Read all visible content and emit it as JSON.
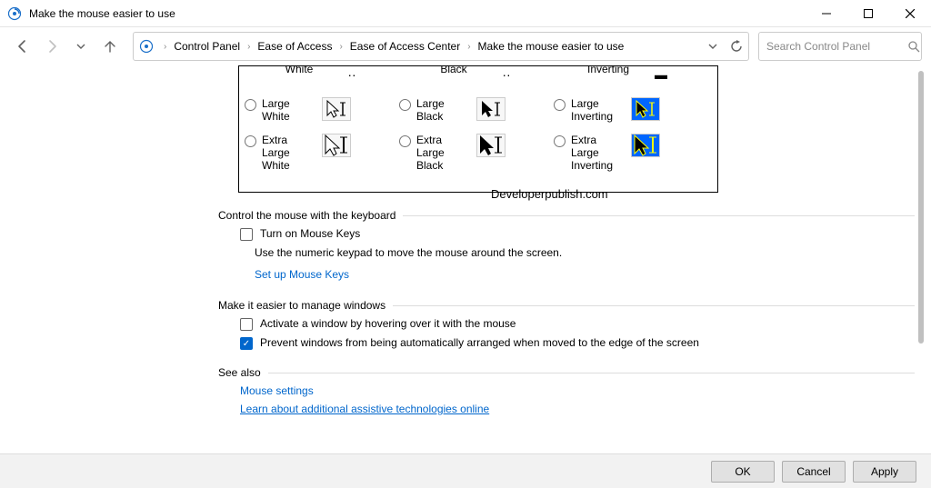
{
  "window": {
    "title": "Make the mouse easier to use"
  },
  "breadcrumbs": {
    "items": [
      "Control Panel",
      "Ease of Access",
      "Ease of Access Center",
      "Make the mouse easier to use"
    ]
  },
  "search": {
    "placeholder": "Search Control Panel"
  },
  "pointer_options": {
    "row_partial": {
      "white": "White",
      "black": "Black",
      "inverting": "Inverting"
    },
    "row1": {
      "white": "Large White",
      "black": "Large Black",
      "inverting": "Large Inverting"
    },
    "row2": {
      "white": "Extra Large White",
      "black": "Extra Large Black",
      "inverting": "Extra Large Inverting"
    }
  },
  "section_keyboard": {
    "title": "Control the mouse with the keyboard",
    "check": {
      "label": "Turn on Mouse Keys",
      "checked": false
    },
    "desc": "Use the numeric keypad to move the mouse around the screen.",
    "link": "Set up Mouse Keys"
  },
  "section_windows": {
    "title": "Make it easier to manage windows",
    "check1": {
      "label": "Activate a window by hovering over it with the mouse",
      "checked": false
    },
    "check2": {
      "label": "Prevent windows from being automatically arranged when moved to the edge of the screen",
      "checked": true
    }
  },
  "see_also": {
    "title": "See also",
    "links": [
      "Mouse settings",
      "Learn about additional assistive technologies online"
    ]
  },
  "buttons": {
    "ok": "OK",
    "cancel": "Cancel",
    "apply": "Apply"
  },
  "watermark": "Developerpublish.com"
}
